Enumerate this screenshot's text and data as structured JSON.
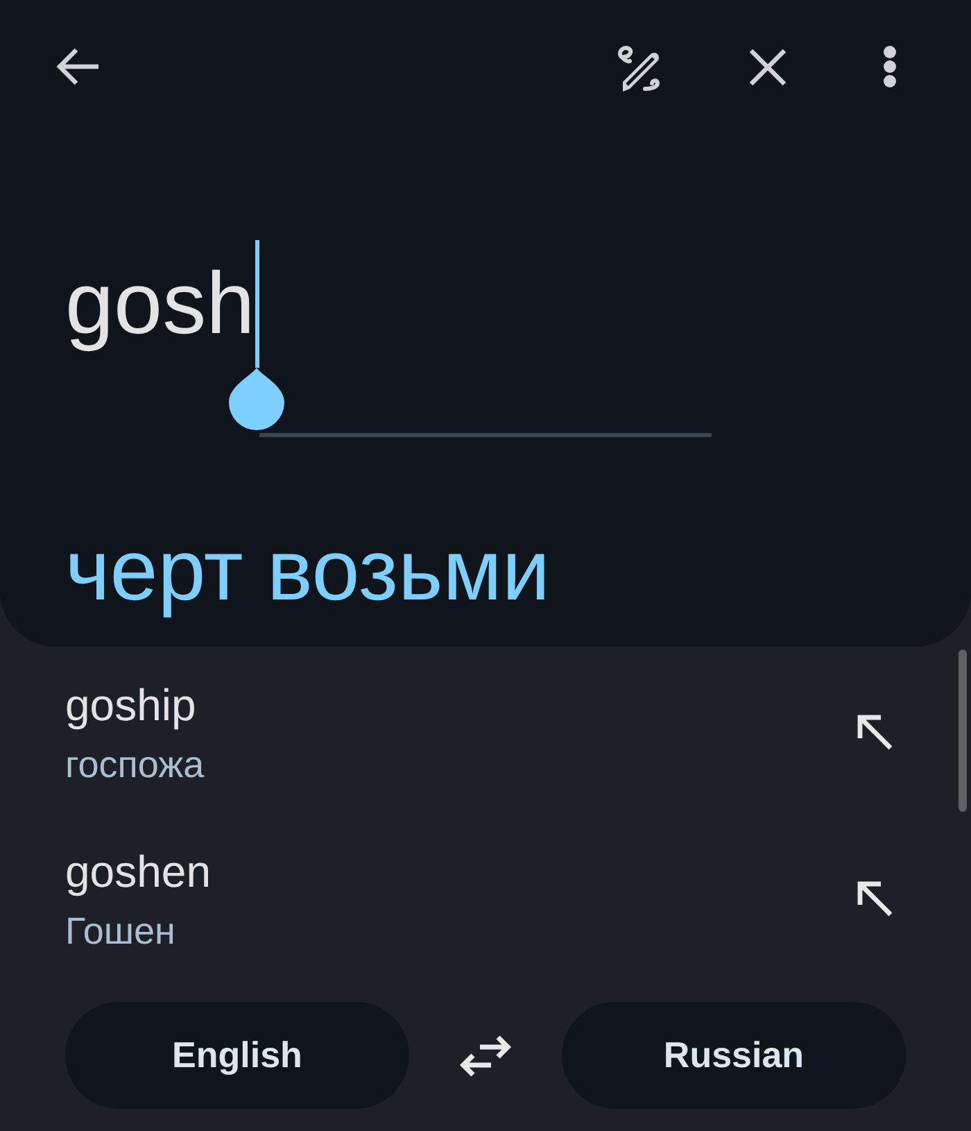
{
  "input": {
    "value": "gosh",
    "focused": true
  },
  "translation": {
    "text": "черт возьми"
  },
  "suggestions": [
    {
      "word": "goship",
      "translation": "госпожа"
    },
    {
      "word": "goshen",
      "translation": "Гошен"
    }
  ],
  "languages": {
    "source": "English",
    "target": "Russian"
  }
}
